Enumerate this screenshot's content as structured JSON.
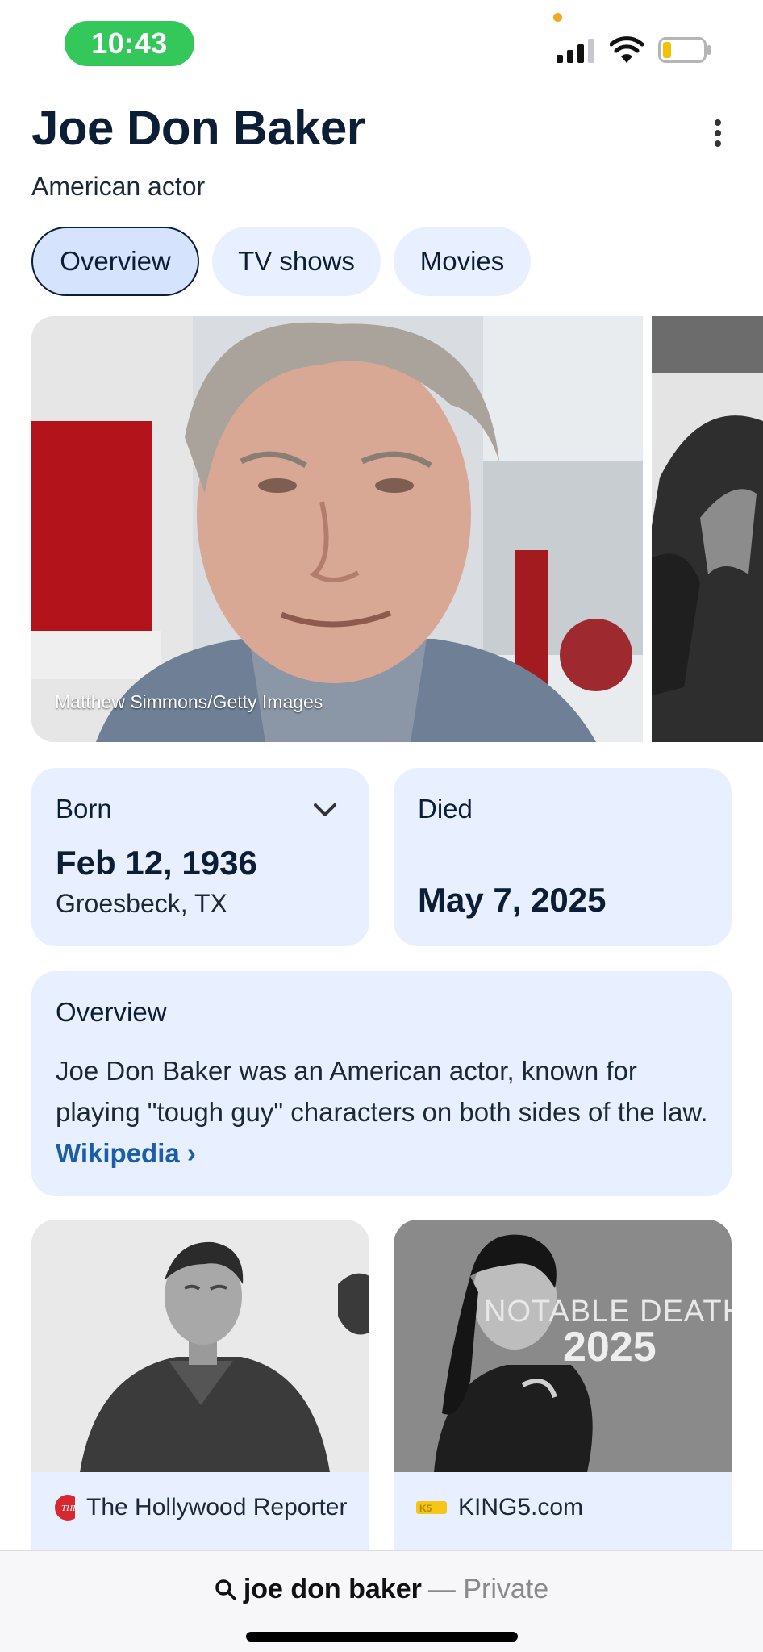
{
  "status_bar": {
    "time": "10:43",
    "icons": [
      "cellular-signal-icon",
      "wifi-icon",
      "battery-low-icon"
    ]
  },
  "entity": {
    "name": "Joe Don Baker",
    "description": "American actor"
  },
  "tabs": [
    {
      "label": "Overview",
      "active": true
    },
    {
      "label": "TV shows",
      "active": false
    },
    {
      "label": "Movies",
      "active": false
    }
  ],
  "photo": {
    "credit": "Matthew Simmons/Getty Images"
  },
  "facts": {
    "born_label": "Born",
    "born_date": "Feb 12, 1936",
    "born_place": "Groesbeck, TX",
    "died_label": "Died",
    "died_date": "May 7, 2025"
  },
  "overview": {
    "title": "Overview",
    "text": "Joe Don Baker was an American actor, known for playing \"tough guy\" characters on both sides of the law.",
    "link_label": "Wikipedia",
    "link_chevron": "›"
  },
  "news": [
    {
      "source": "The Hollywood Reporter",
      "source_icon": "hollywood-reporter-logo"
    },
    {
      "source": "KING5.com",
      "source_icon": "king5-logo",
      "image_text_1": "NOTABLE DEATH",
      "image_text_2": "2025"
    }
  ],
  "search": {
    "query": "joe don baker",
    "mode": "— Private"
  },
  "colors": {
    "card_bg": "#e8efff",
    "accent_link": "#1a5ea8",
    "time_pill": "#34c759"
  }
}
